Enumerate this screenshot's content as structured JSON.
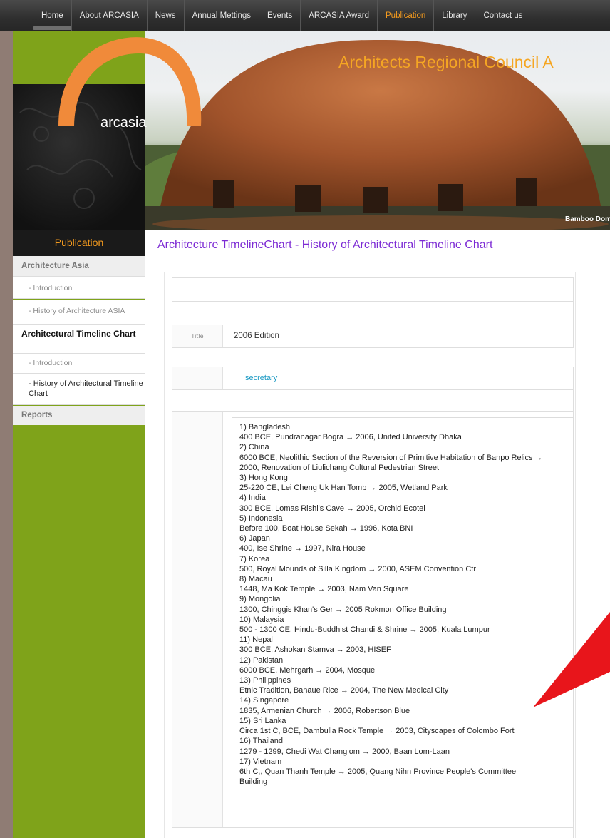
{
  "nav": {
    "items": [
      "Home",
      "About ARCASIA",
      "News",
      "Annual Mettings",
      "Events",
      "ARCASIA Award",
      "Publication",
      "Library",
      "Contact us"
    ],
    "active": "Publication"
  },
  "hero": {
    "logo_text": "arcasia",
    "title": "Architects Regional Council A",
    "caption": "Bamboo Dome Bi"
  },
  "sidebar": {
    "header": "Publication",
    "items": [
      {
        "label": "Architecture Asia",
        "type": "section"
      },
      {
        "label": "- Introduction",
        "type": "sub"
      },
      {
        "label": "- History of Architecture ASIA",
        "type": "sub"
      },
      {
        "label": "Architectural Timeline Chart",
        "type": "section-active"
      },
      {
        "label": "- Introduction",
        "type": "sub"
      },
      {
        "label": "- History of Architectural Timeline Chart",
        "type": "sub-active"
      },
      {
        "label": "Reports",
        "type": "section"
      }
    ]
  },
  "main": {
    "page_title": "Architecture TimelineChart - History of Architectural Timeline Chart",
    "title_label": "Title",
    "title_value": "2006 Edition",
    "author": "secretary",
    "lines": [
      "1) Bangladesh",
      "400 BCE, Pundranagar Bogra → 2006, United University Dhaka",
      "2) China",
      "6000 BCE, Neolithic Section of the Reversion of Primitive Habitation of Banpo Relics →",
      "2000, Renovation of Liulichang Cultural Pedestrian Street",
      "3) Hong Kong",
      "25-220 CE, Lei Cheng Uk Han Tomb → 2005, Wetland Park",
      "4) India",
      "300 BCE, Lomas Rishi's Cave → 2005, Orchid Ecotel",
      "5) Indonesia",
      "Before 100, Boat House Sekah → 1996, Kota BNI",
      "6) Japan",
      "400, Ise Shrine → 1997, Nira House",
      "7) Korea",
      "500, Royal Mounds of Silla Kingdom → 2000, ASEM Convention Ctr",
      "8) Macau",
      "1448, Ma Kok Temple → 2003, Nam Van Square",
      "9) Mongolia",
      "1300, Chinggis Khan's Ger → 2005 Rokmon Office Building",
      "10) Malaysia",
      "500 - 1300 CE, Hindu-Buddhist Chandi & Shrine → 2005, Kuala Lumpur",
      "11) Nepal",
      "300 BCE, Ashokan Stamva → 2003, HISEF",
      "12) Pakistan",
      "6000 BCE, Mehrgarh → 2004, Mosque",
      "13) Philippines",
      "Etnic Tradition, Banaue Rice → 2004, The New Medical City",
      "14) Singapore",
      "1835, Armenian Church → 2006, Robertson Blue",
      "15) Sri Lanka",
      "Circa 1st C, BCE, Dambulla Rock Temple → 2003, Cityscapes of Colombo Fort",
      "16) Thailand",
      "1279 - 1299, Chedi Wat Changlom → 2000, Baan Lom-Laan",
      "17) Vietnam",
      "6th C,, Quan Thanh Temple → 2005, Quang Nihn Province People's Committee",
      "Building"
    ]
  }
}
